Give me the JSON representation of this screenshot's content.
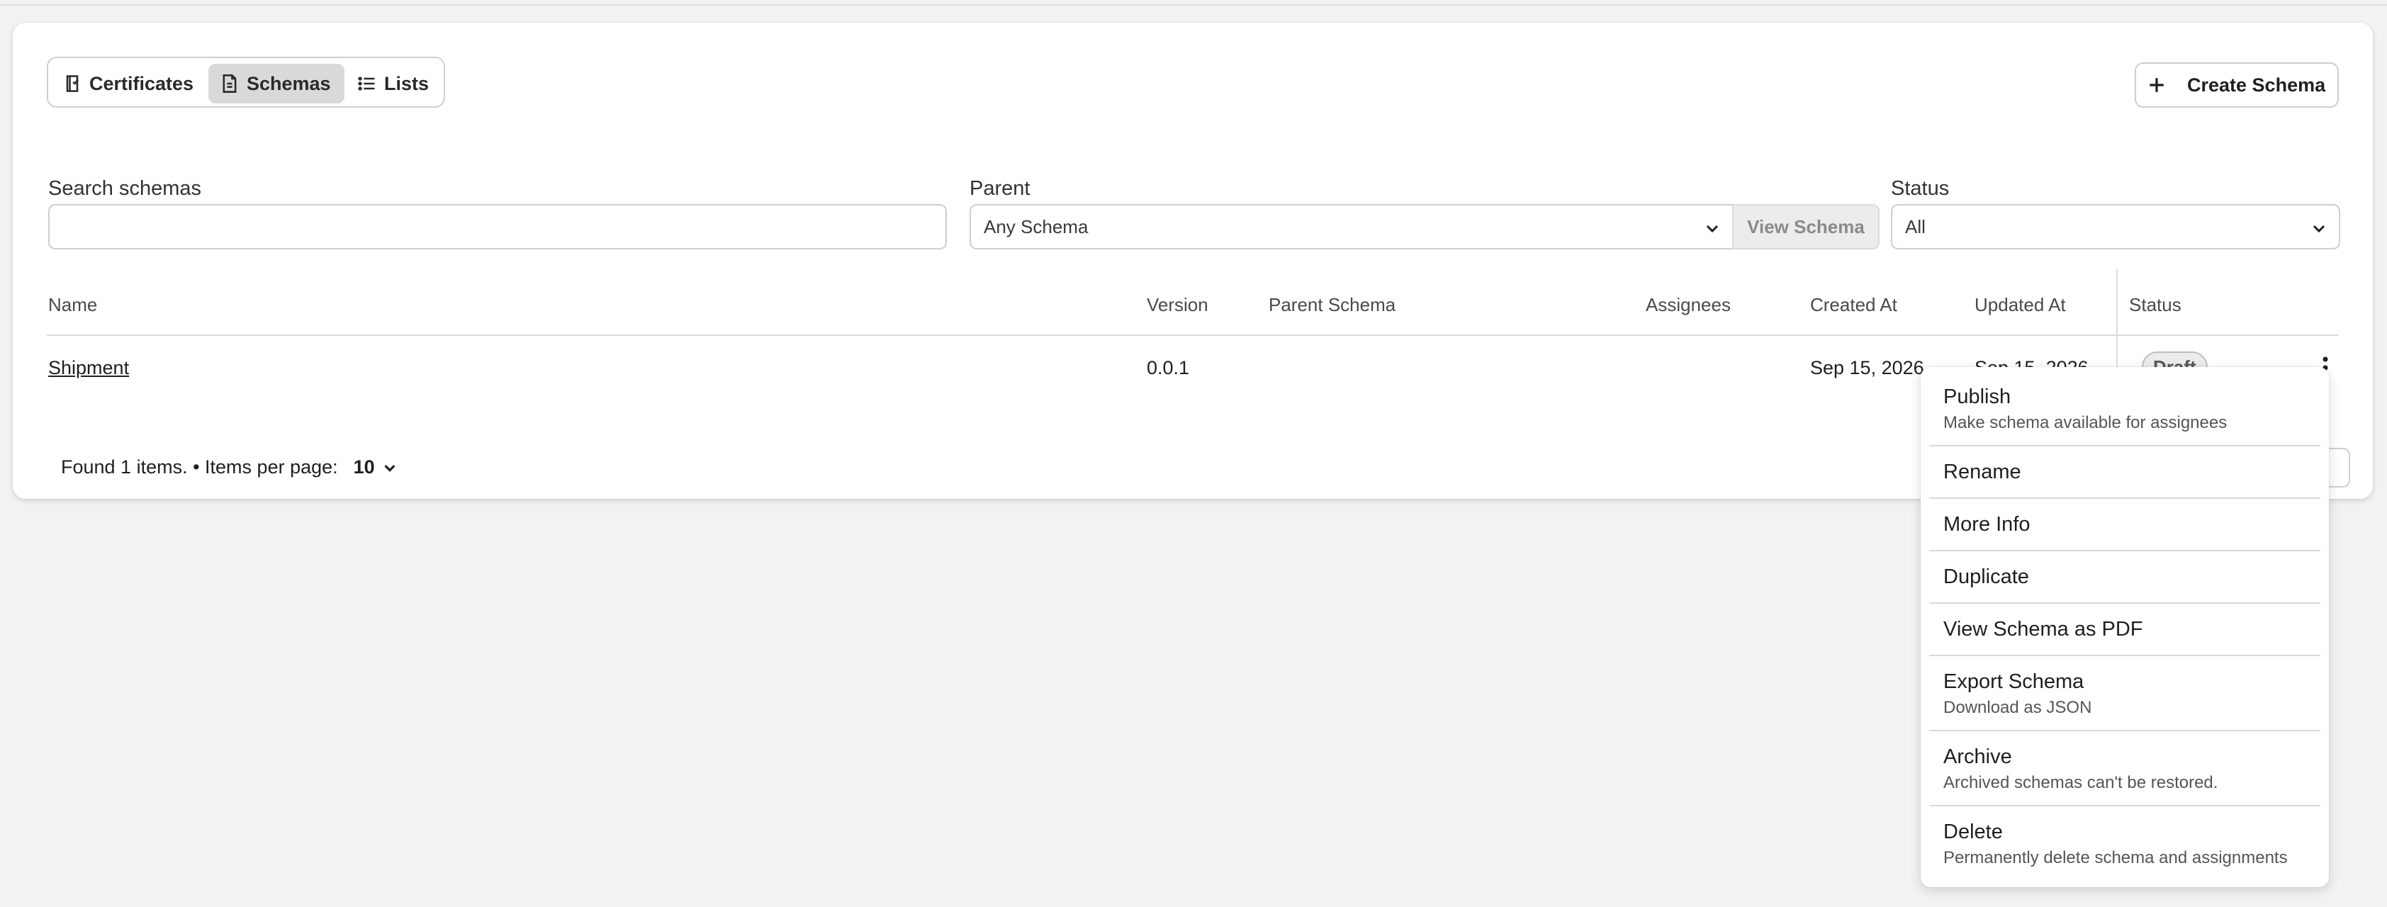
{
  "tabs": [
    {
      "label": "Certificates",
      "icon": "certificate-icon",
      "active": false
    },
    {
      "label": "Schemas",
      "icon": "schema-file-icon",
      "active": true
    },
    {
      "label": "Lists",
      "icon": "list-icon",
      "active": false
    }
  ],
  "create_button": {
    "label": "Create Schema",
    "icon": "plus-icon"
  },
  "filters": {
    "search": {
      "label": "Search schemas",
      "value": ""
    },
    "parent": {
      "label": "Parent",
      "value": "Any Schema",
      "view_button": "View Schema"
    },
    "status": {
      "label": "Status",
      "value": "All"
    }
  },
  "table": {
    "columns": [
      "Name",
      "Version",
      "Parent Schema",
      "Assignees",
      "Created At",
      "Updated At",
      "Status"
    ],
    "rows": [
      {
        "name": "Shipment",
        "version": "0.0.1",
        "parent": "",
        "assignees": "",
        "created": "Sep 15, 2026",
        "updated": "Sep 15, 2026",
        "status": "Draft"
      }
    ]
  },
  "footer": {
    "found_text": "Found 1 items. • Items per page:",
    "per_page": "10"
  },
  "menu": {
    "items": [
      {
        "title": "Publish",
        "subtitle": "Make schema available for assignees"
      },
      {
        "title": "Rename",
        "subtitle": ""
      },
      {
        "title": "More Info",
        "subtitle": ""
      },
      {
        "title": "Duplicate",
        "subtitle": ""
      },
      {
        "title": "View Schema as PDF",
        "subtitle": ""
      },
      {
        "title": "Export Schema",
        "subtitle": "Download as JSON"
      },
      {
        "title": "Archive",
        "subtitle": "Archived schemas can't be restored."
      },
      {
        "title": "Delete",
        "subtitle": "Permanently delete schema and assignments"
      }
    ]
  },
  "colors": {
    "active_tab": "#d9d9d9",
    "badge_bg": "#ececec",
    "page_bg": "#f2f2f2"
  }
}
